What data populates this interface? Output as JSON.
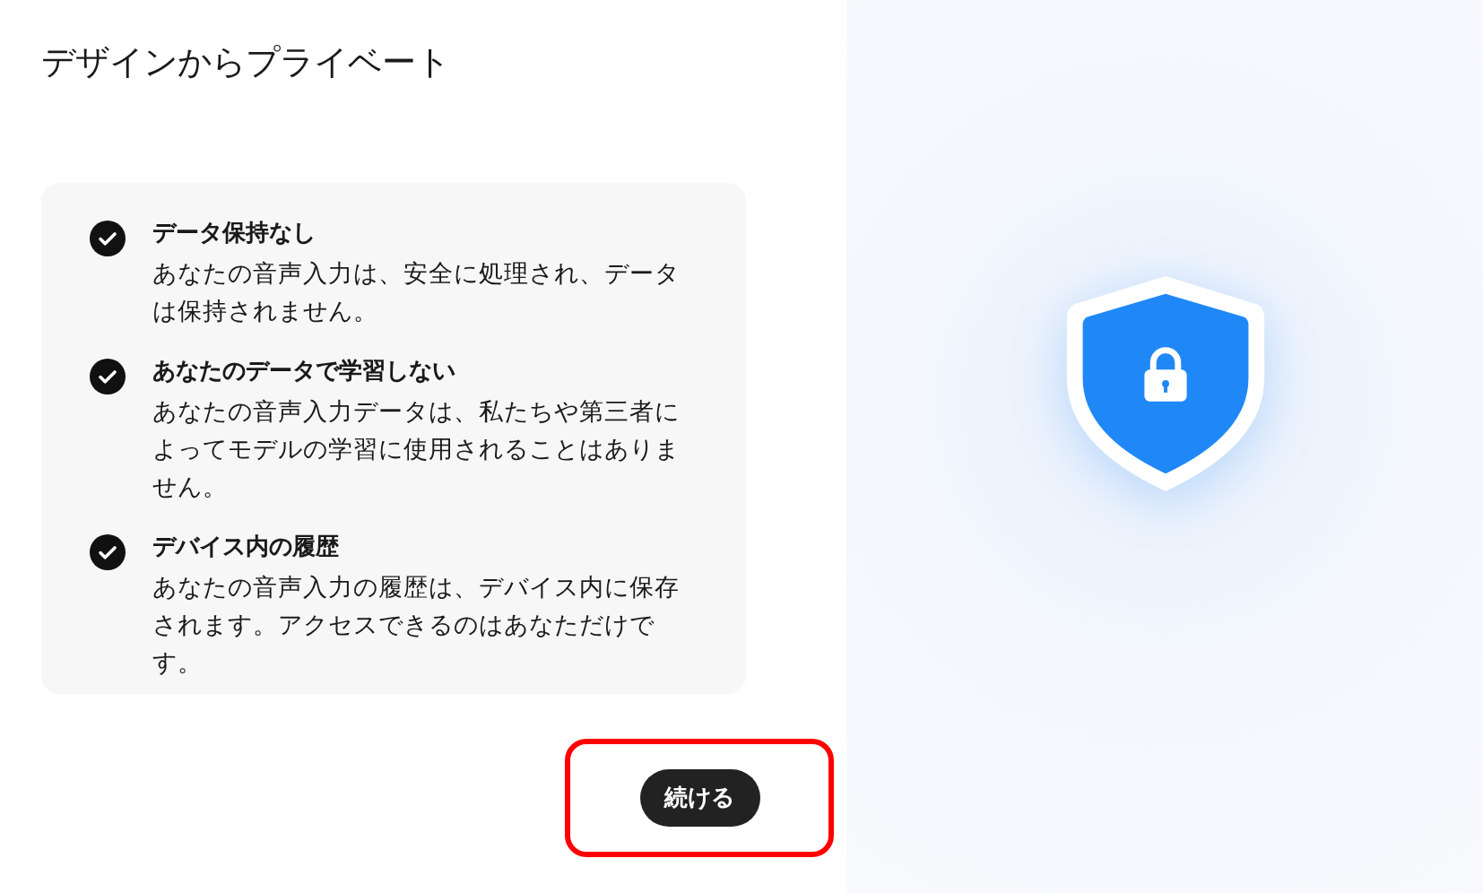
{
  "title": "デザインからプライベート",
  "features": [
    {
      "title": "データ保持なし",
      "description": "あなたの音声入力は、安全に処理され、データは保持されません。"
    },
    {
      "title": "あなたのデータで学習しない",
      "description": "あなたの音声入力データは、私たちや第三者によってモデルの学習に使用されることはありません。"
    },
    {
      "title": "デバイス内の履歴",
      "description": "あなたの音声入力の履歴は、デバイス内に保存されます。アクセスできるのはあなただけです。"
    }
  ],
  "button": "続ける"
}
